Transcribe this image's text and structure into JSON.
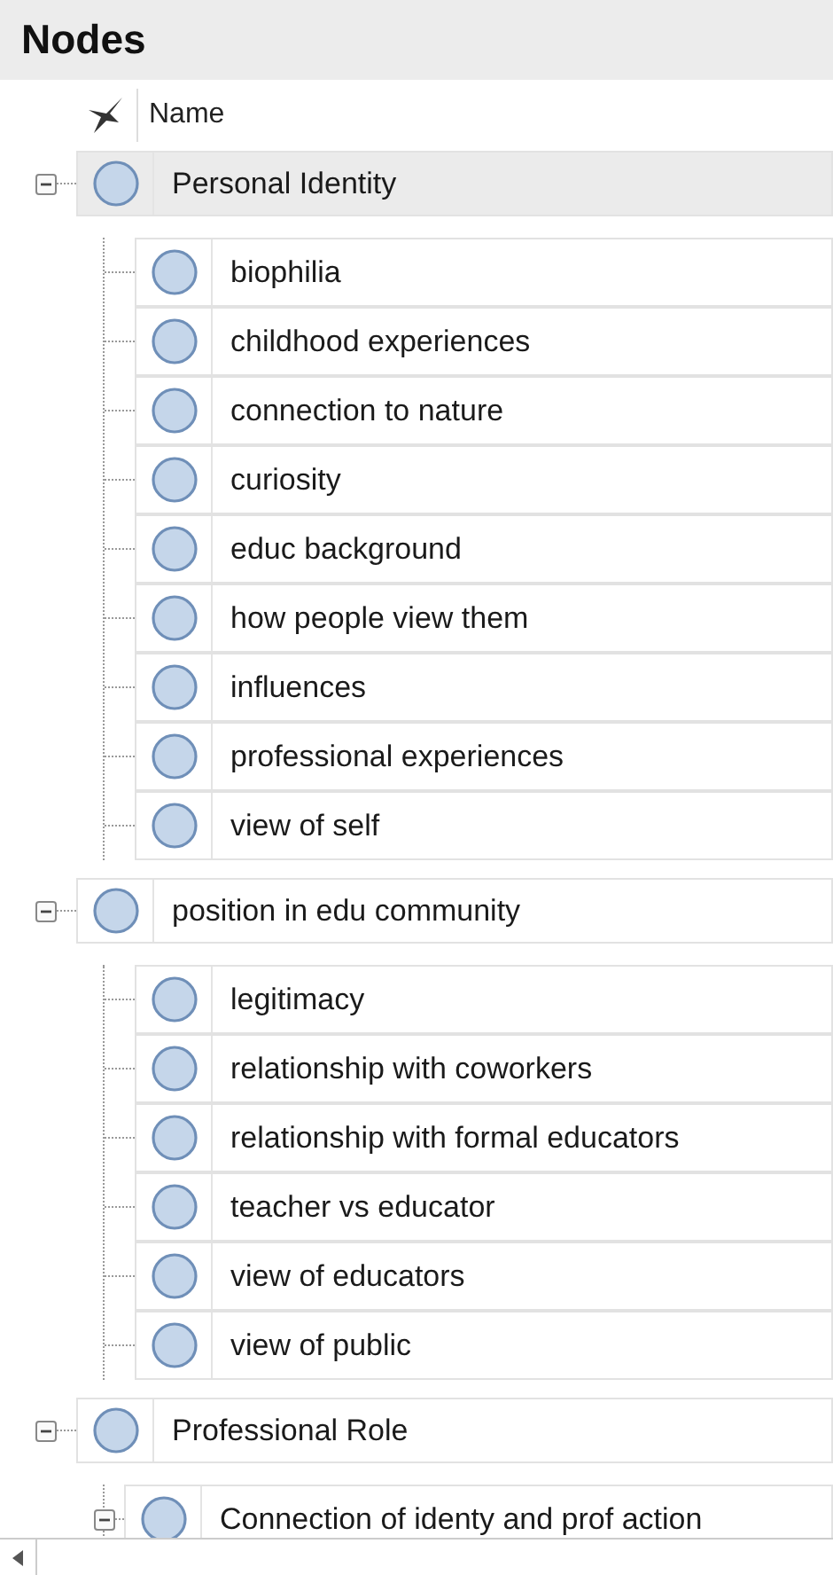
{
  "panel": {
    "title": "Nodes"
  },
  "columns": [
    {
      "label": "Name"
    }
  ],
  "nodes": [
    {
      "name": "Personal Identity",
      "expanded": true,
      "selected": true,
      "children": [
        {
          "name": "biophilia",
          "selected": false
        },
        {
          "name": "childhood experiences",
          "selected": false
        },
        {
          "name": "connection to nature",
          "selected": false
        },
        {
          "name": "curiosity",
          "selected": false
        },
        {
          "name": "educ background",
          "selected": false
        },
        {
          "name": "how people view them",
          "selected": false
        },
        {
          "name": "influences",
          "selected": false
        },
        {
          "name": "professional experiences",
          "selected": false
        },
        {
          "name": "view of self",
          "selected": false
        }
      ]
    },
    {
      "name": "position in edu community",
      "expanded": true,
      "selected": false,
      "children": [
        {
          "name": "legitimacy",
          "selected": false
        },
        {
          "name": "relationship with coworkers",
          "selected": false
        },
        {
          "name": "relationship with formal educators",
          "selected": false
        },
        {
          "name": "teacher vs educator",
          "selected": false
        },
        {
          "name": "view of educators",
          "selected": false
        },
        {
          "name": "view of public",
          "selected": false
        }
      ]
    },
    {
      "name": "Professional Role",
      "expanded": true,
      "selected": false,
      "children": [
        {
          "name": "Connection of identy and prof action",
          "expanded": true,
          "selected": false
        }
      ]
    }
  ]
}
